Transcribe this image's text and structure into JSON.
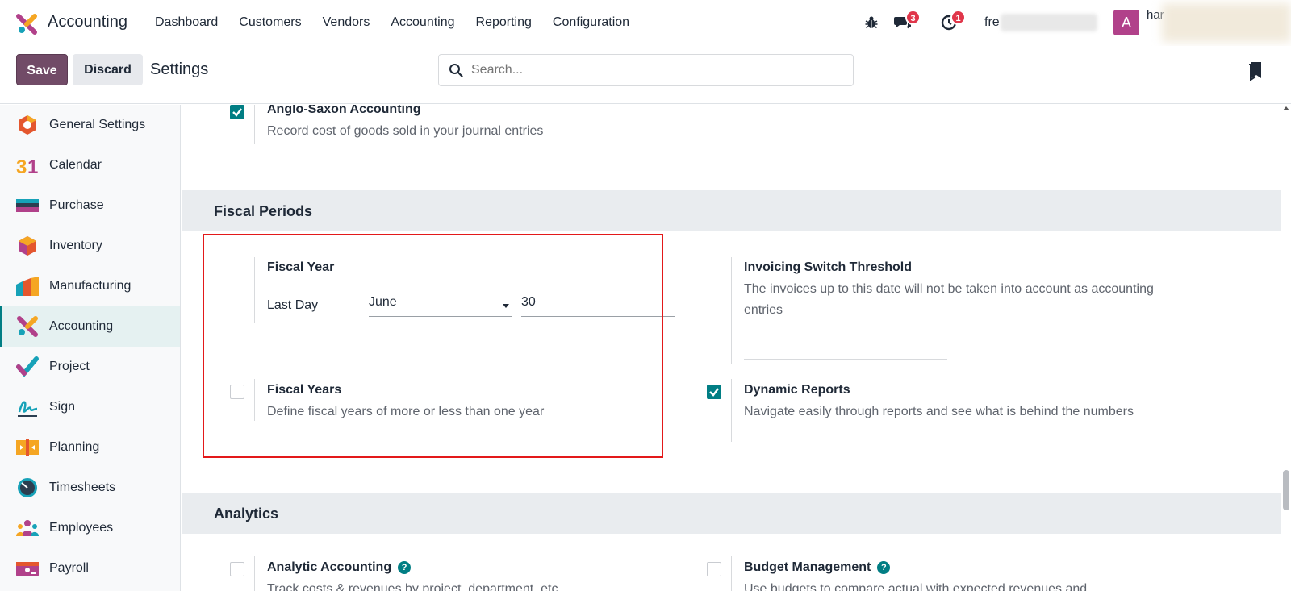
{
  "navbar": {
    "app_name": "Accounting",
    "menu": [
      "Dashboard",
      "Customers",
      "Vendors",
      "Accounting",
      "Reporting",
      "Configuration"
    ],
    "messages_count": "3",
    "activities_count": "1",
    "company": "fre",
    "avatar_letter": "A",
    "user": "har"
  },
  "controlbar": {
    "save_label": "Save",
    "discard_label": "Discard",
    "title": "Settings",
    "search_placeholder": "Search..."
  },
  "sidebar": {
    "items": [
      {
        "label": "General Settings",
        "icon": "general-settings-icon"
      },
      {
        "label": "Calendar",
        "icon": "calendar-icon"
      },
      {
        "label": "Purchase",
        "icon": "purchase-icon"
      },
      {
        "label": "Inventory",
        "icon": "inventory-icon"
      },
      {
        "label": "Manufacturing",
        "icon": "manufacturing-icon"
      },
      {
        "label": "Accounting",
        "icon": "accounting-icon",
        "active": true
      },
      {
        "label": "Project",
        "icon": "project-icon"
      },
      {
        "label": "Sign",
        "icon": "sign-icon"
      },
      {
        "label": "Planning",
        "icon": "planning-icon"
      },
      {
        "label": "Timesheets",
        "icon": "timesheets-icon"
      },
      {
        "label": "Employees",
        "icon": "employees-icon"
      },
      {
        "label": "Payroll",
        "icon": "payroll-icon"
      }
    ]
  },
  "content": {
    "anglo": {
      "title": "Anglo-Saxon Accounting",
      "desc": "Record cost of goods sold in your journal entries",
      "checked": true
    },
    "fiscal_periods": {
      "section_title": "Fiscal Periods",
      "fiscal_year": {
        "title": "Fiscal Year",
        "last_day_label": "Last Day",
        "month": "June",
        "day": "30"
      },
      "fiscal_years": {
        "title": "Fiscal Years",
        "desc": "Define fiscal years of more or less than one year",
        "checked": false
      },
      "invoicing_threshold": {
        "title": "Invoicing Switch Threshold",
        "desc": "The invoices up to this date will not be taken into account as accounting entries"
      },
      "dynamic_reports": {
        "title": "Dynamic Reports",
        "desc": "Navigate easily through reports and see what is behind the numbers",
        "checked": true
      }
    },
    "analytics": {
      "section_title": "Analytics",
      "analytic_accounting": {
        "title": "Analytic Accounting",
        "desc": "Track costs & revenues by project, department, etc",
        "checked": false
      },
      "budget_management": {
        "title": "Budget Management",
        "desc": "Use budgets to compare actual with expected revenues and",
        "checked": false
      }
    }
  },
  "colors": {
    "brand": "#714b67",
    "accent": "#017e84",
    "badge": "#e0364a",
    "highlight": "#e3191a"
  }
}
